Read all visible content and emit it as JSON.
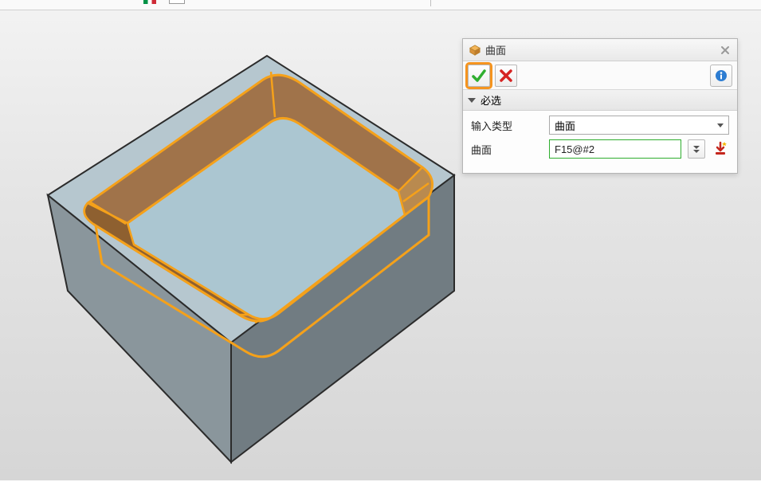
{
  "panel": {
    "title": "曲面",
    "ok_tooltip": "确定",
    "cancel_tooltip": "取消",
    "info_tooltip": "信息",
    "close_tooltip": "关闭",
    "section_required_label": "必选",
    "rows": {
      "input_type_label": "输入类型",
      "input_type_value": "曲面",
      "surface_label": "曲面",
      "surface_value": "F15@#2"
    },
    "expand_tooltip": "展开",
    "import_tooltip": "导入"
  },
  "icons": {
    "cube": "cube-icon",
    "check": "check-icon",
    "cross": "cross-icon",
    "info": "info-icon",
    "close": "close-icon",
    "chevrons": "double-chevron-down-icon",
    "download_star": "import-star-icon"
  }
}
